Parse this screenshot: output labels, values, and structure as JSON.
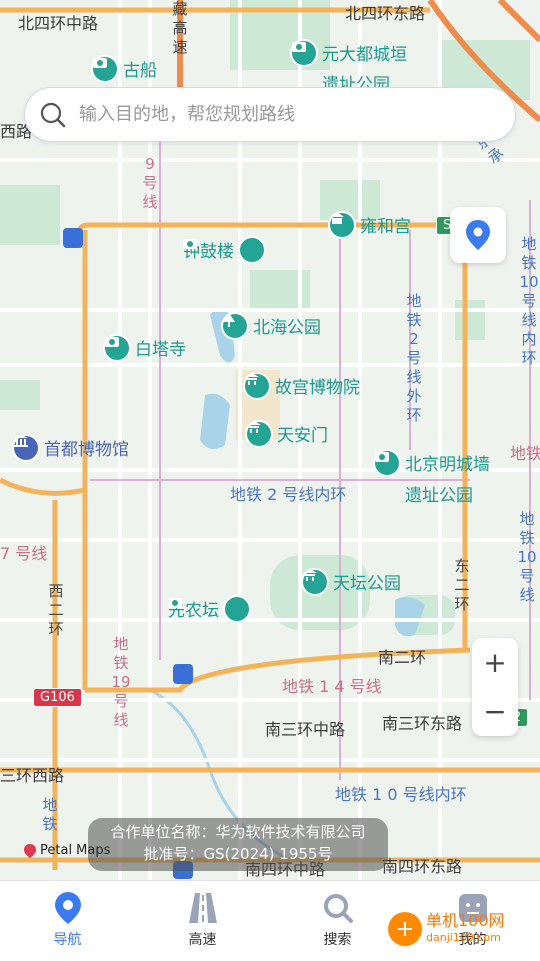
{
  "map": {
    "road_labels": [
      {
        "id": "n4-west",
        "text": "北四环中路"
      },
      {
        "id": "n4-east",
        "text": "北四环东路"
      },
      {
        "id": "xisilu",
        "text": "西路"
      },
      {
        "id": "s3-mid",
        "text": "南三环中路"
      },
      {
        "id": "s3-east",
        "text": "南三环东路"
      },
      {
        "id": "s2",
        "text": "南二环"
      },
      {
        "id": "s4-mid",
        "text": "南四环中路"
      },
      {
        "id": "s4-east",
        "text": "南四环东路"
      },
      {
        "id": "w3",
        "text": "三环西路"
      },
      {
        "id": "subway-2-inner",
        "text": "地铁 2 号线内环"
      },
      {
        "id": "subway-14",
        "text": "地铁 1 4 号线"
      },
      {
        "id": "subway-10-inner",
        "text": "地铁 1 0 号线内环"
      },
      {
        "id": "line7",
        "text": "7 号线"
      },
      {
        "id": "ditie-right",
        "text": "地铁"
      }
    ],
    "vertical_labels": [
      {
        "id": "zanggao",
        "text": "藏高速"
      },
      {
        "id": "line9",
        "text": "9号线"
      },
      {
        "id": "line2-outer",
        "text": "地铁2号线外环"
      },
      {
        "id": "line10-inner-v",
        "text": "地铁10号线内环"
      },
      {
        "id": "west2",
        "text": "西二环"
      },
      {
        "id": "east2",
        "text": "东二环"
      },
      {
        "id": "line19",
        "text": "地铁19号线"
      },
      {
        "id": "line10-right",
        "text": "地铁10号线"
      },
      {
        "id": "ditie-left",
        "text": "地铁"
      },
      {
        "id": "jing-cheng",
        "text": "京承"
      }
    ],
    "pois": [
      {
        "id": "gu-chuan",
        "text": "古船",
        "icon": "camera-icon"
      },
      {
        "id": "yuan-dadu",
        "text": "元大都城垣",
        "icon": "camera-icon"
      },
      {
        "id": "yuan-dadu-2",
        "text": "遗址公园"
      },
      {
        "id": "yonghegong",
        "text": "雍和宫",
        "icon": "temple-icon"
      },
      {
        "id": "zhonggulou",
        "text": "钟鼓楼",
        "icon": "camera-icon"
      },
      {
        "id": "beihai",
        "text": "北海公园",
        "icon": "tree-icon"
      },
      {
        "id": "baitasi",
        "text": "白塔寺",
        "icon": "camera-icon"
      },
      {
        "id": "gugong",
        "text": "故宫博物院",
        "icon": "palace-icon"
      },
      {
        "id": "tiananmen",
        "text": "天安门",
        "icon": "palace-icon"
      },
      {
        "id": "shoudu",
        "text": "首都博物馆",
        "icon": "museum-icon"
      },
      {
        "id": "mingchengqiang",
        "text": "北京明城墙",
        "icon": "camera-icon"
      },
      {
        "id": "mingchengqiang-2",
        "text": "遗址公园"
      },
      {
        "id": "tiantan",
        "text": "天坛公园",
        "icon": "palace-icon"
      },
      {
        "id": "xiannongtan",
        "text": "先农坛",
        "icon": "camera-icon"
      }
    ],
    "road_signs": [
      {
        "id": "g106",
        "text": "G106"
      },
      {
        "id": "s-top",
        "text": "S"
      },
      {
        "id": "g-right",
        "text": "2"
      }
    ]
  },
  "search": {
    "placeholder": "输入目的地，帮您规划路线"
  },
  "zoom": {
    "in": "+",
    "out": "−"
  },
  "credit": {
    "line1": "合作单位名称：华为软件技术有限公司",
    "line2": "批准号：GS(2024) 1955号"
  },
  "petal": {
    "label": "Petal Maps"
  },
  "nav": [
    {
      "label": "导航",
      "icon": "navigation-pin-icon",
      "active": true
    },
    {
      "label": "高速",
      "icon": "highway-icon",
      "active": false
    },
    {
      "label": "搜索",
      "icon": "search-icon",
      "active": false
    },
    {
      "label": "我的",
      "icon": "profile-icon",
      "active": false
    }
  ],
  "watermark": {
    "name": "单机100网",
    "url": "danji100.com"
  },
  "colors": {
    "accent": "#3a7bf0",
    "poi": "#23a495",
    "ring_road": "#f2b35a",
    "water": "#a9d3e8"
  }
}
